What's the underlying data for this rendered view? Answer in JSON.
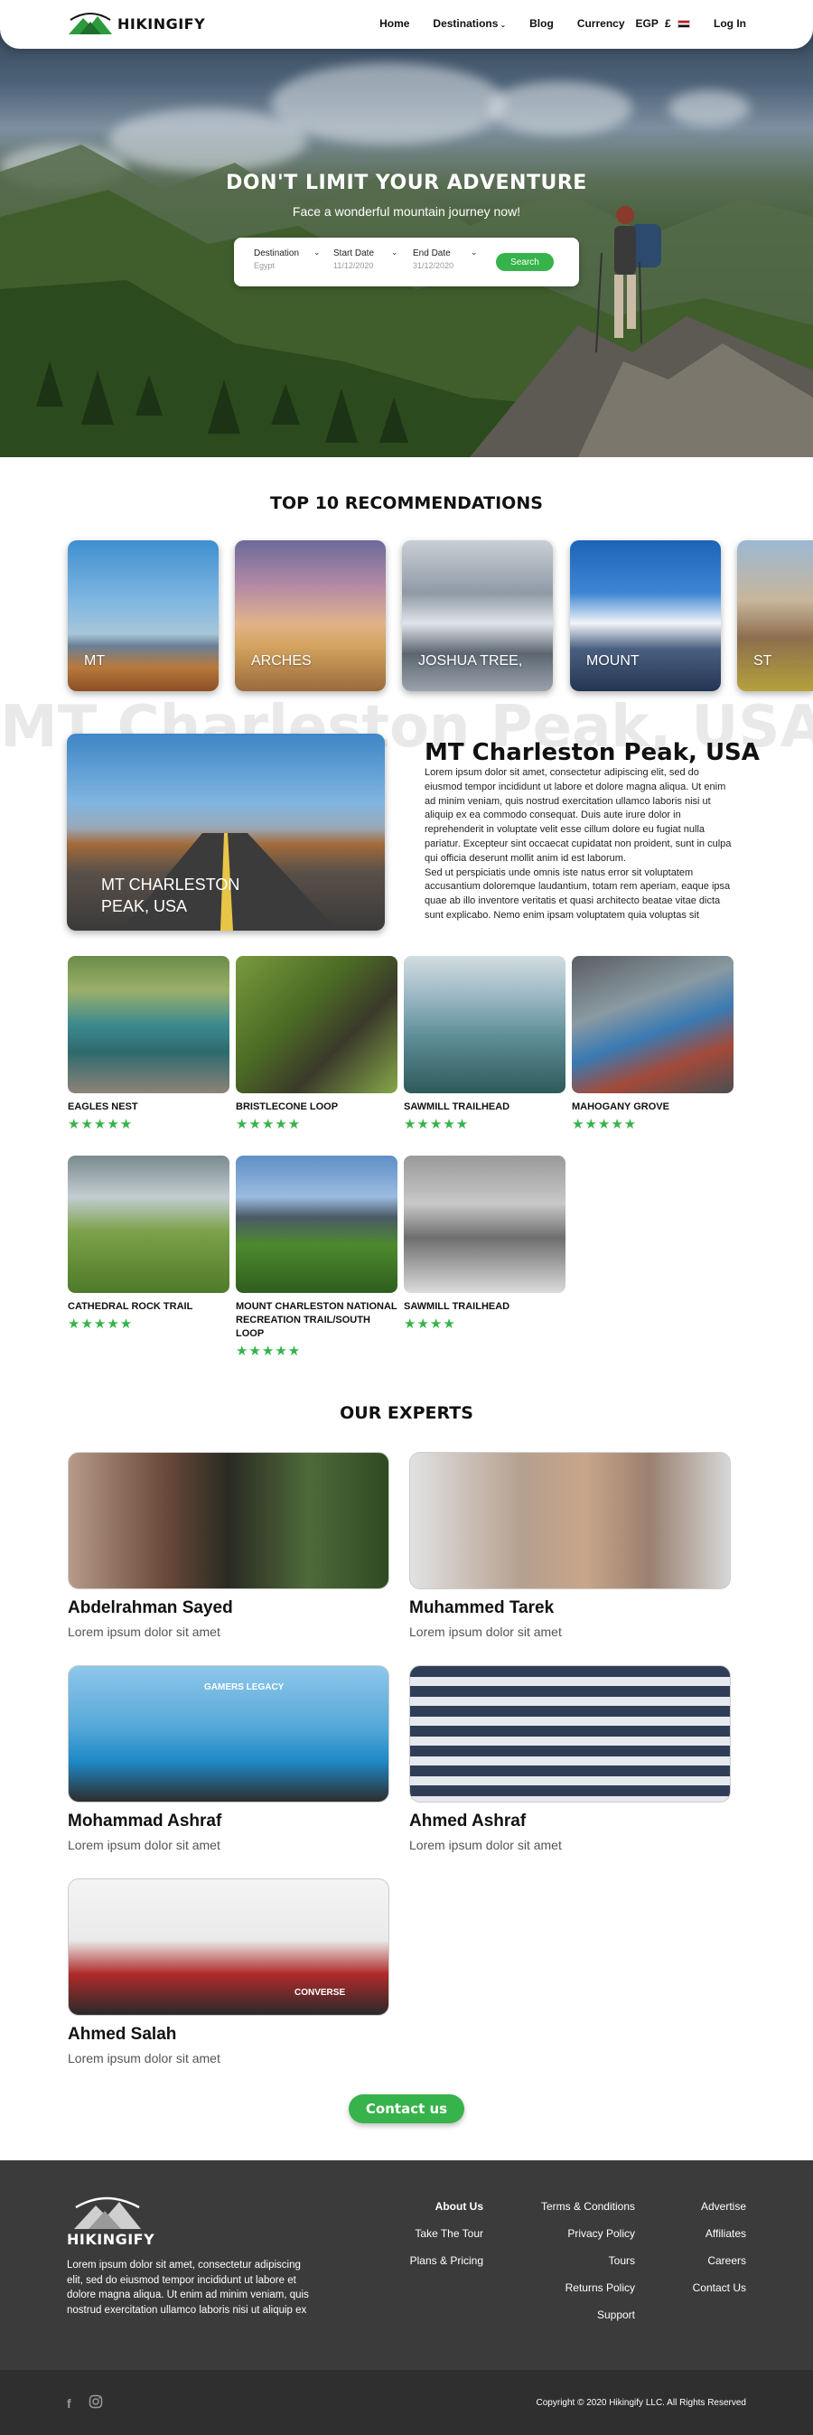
{
  "nav": {
    "brand": "HIKINGIFY",
    "links": {
      "home": "Home",
      "destinations": "Destinations",
      "blog": "Blog",
      "currency": "Currency"
    },
    "currency_value": "EGP",
    "currency_symbol": "£",
    "login": "Log In"
  },
  "hero": {
    "title": "DON'T LIMIT YOUR ADVENTURE",
    "subtitle": "Face a wonderful mountain journey now!",
    "search": {
      "destination_label": "Destination",
      "destination_value": "Egypt",
      "start_label": "Start Date",
      "start_value": "11/12/2020",
      "end_label": "End Date",
      "end_value": "31/12/2020",
      "button": "Search"
    }
  },
  "recommendations": {
    "title": "TOP 10 RECOMMENDATIONS",
    "cards": [
      "MT",
      "ARCHES",
      "JOSHUA TREE,",
      "MOUNT",
      "ST"
    ],
    "background_title": "MT Charleston Peak, USA",
    "feature": {
      "image_caption": "MT CHARLESTON PEAK, USA",
      "title": "MT Charleston Peak, USA",
      "text": "Lorem ipsum dolor sit amet, consectetur adipiscing elit, sed do eiusmod tempor incididunt ut labore et dolore magna aliqua. Ut enim ad minim veniam, quis nostrud exercitation ullamco laboris nisi ut aliquip ex ea commodo consequat. Duis aute irure dolor in reprehenderit in voluptate velit esse cillum dolore eu fugiat nulla pariatur. Excepteur sint occaecat cupidatat non proident, sunt in culpa qui officia deserunt mollit anim id est laborum.",
      "text2": "Sed ut perspiciatis unde omnis iste natus error sit voluptatem accusantium doloremque laudantium, totam rem aperiam, eaque ipsa quae ab illo inventore veritatis et quasi architecto beatae vitae dicta sunt explicabo. Nemo enim ipsam voluptatem quia voluptas sit"
    },
    "trails": [
      {
        "name": "EAGLES NEST",
        "rating": 5
      },
      {
        "name": "BRISTLECONE LOOP",
        "rating": 5
      },
      {
        "name": "SAWMILL TRAILHEAD",
        "rating": 5
      },
      {
        "name": "MAHOGANY GROVE",
        "rating": 5
      },
      {
        "name": "CATHEDRAL ROCK TRAIL",
        "rating": 5
      },
      {
        "name": "MOUNT CHARLESTON NATIONAL RECREATION TRAIL/SOUTH LOOP",
        "rating": 5
      },
      {
        "name": "SAWMILL TRAILHEAD",
        "rating": 4
      }
    ]
  },
  "experts": {
    "title": "OUR EXPERTS",
    "people": [
      {
        "name": "Abdelrahman Sayed",
        "desc": "Lorem ipsum dolor sit amet"
      },
      {
        "name": "Muhammed Tarek",
        "desc": "Lorem ipsum dolor sit amet"
      },
      {
        "name": "Mohammad Ashraf",
        "desc": "Lorem ipsum dolor sit amet"
      },
      {
        "name": "Ahmed Ashraf",
        "desc": "Lorem ipsum dolor sit amet"
      },
      {
        "name": "Ahmed Salah",
        "desc": "Lorem ipsum dolor sit amet"
      }
    ],
    "cap_text": "GAMERS LEGACY",
    "shirt_text": "CONVERSE",
    "contact": "Contact us"
  },
  "footer": {
    "brand": "HIKINGIFY",
    "description": "Lorem ipsum dolor sit amet, consectetur adipiscing elit, sed do eiusmod tempor incididunt ut labore et dolore magna aliqua. Ut enim ad minim veniam, quis nostrud exercitation ullamco laboris nisi ut aliquip ex",
    "col1": [
      "About Us",
      "Take The Tour",
      "Plans & Pricing"
    ],
    "col2": [
      "Terms & Conditions",
      "Privacy Policy",
      "Tours",
      "Returns Policy",
      "Support"
    ],
    "col3": [
      "Advertise",
      "Affiliates",
      "Careers",
      "Contact Us"
    ],
    "copyright": "Copyright © 2020 Hikingify LLC. All Rights Reserved",
    "icons": [
      "facebook-icon",
      "instagram-icon"
    ]
  },
  "colors": {
    "accent": "#36b34a",
    "footer": "#3b3b3c",
    "subfooter": "#2f2f30"
  }
}
